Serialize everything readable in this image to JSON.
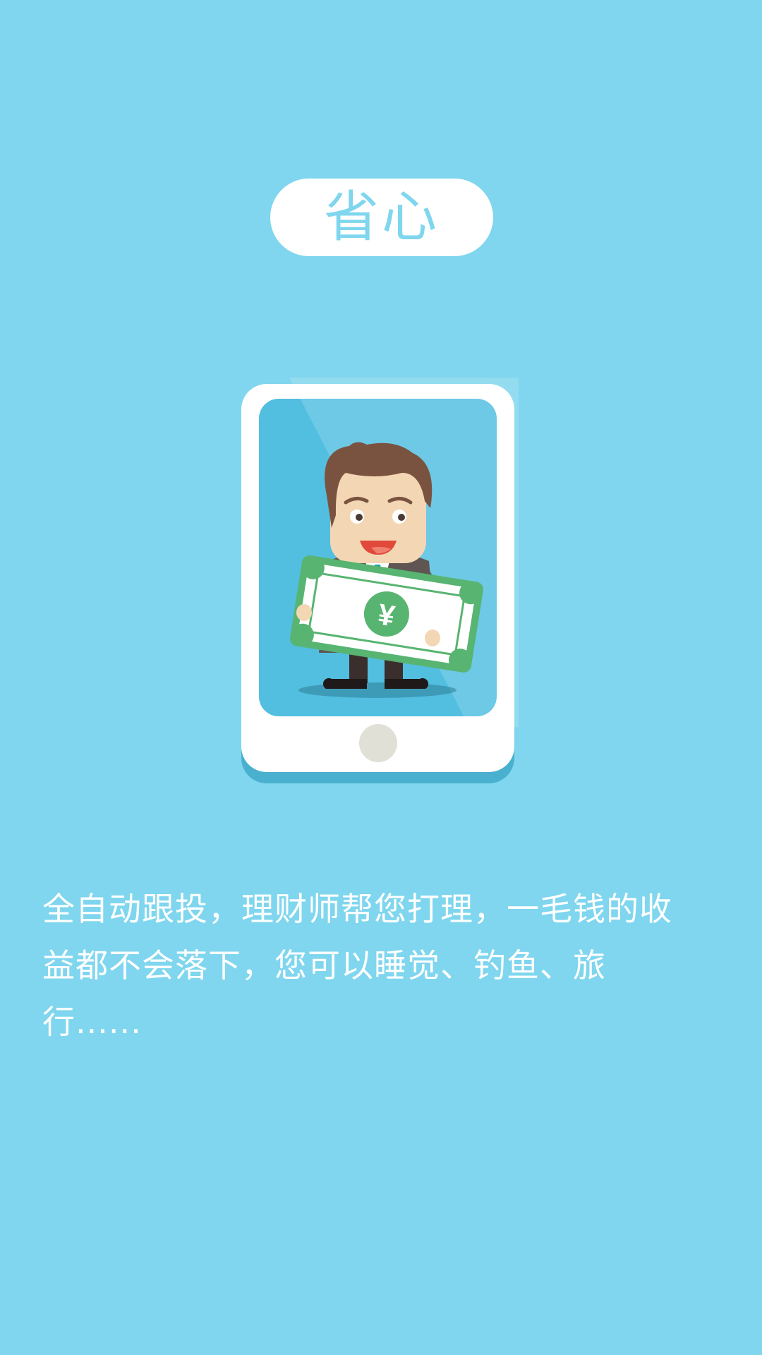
{
  "screen": {
    "title": "省心",
    "description": "全自动跟投，理财师帮您打理，一毛钱的收益都不会落下，您可以睡觉、钓鱼、旅行......",
    "currency_symbol": "¥"
  },
  "colors": {
    "background": "#7fd6ee",
    "pill_background": "#ffffff",
    "title_text": "#7fd6ee",
    "body_text": "#ffffff"
  },
  "illustration": {
    "subject": "businessman holding a banknote inside a smartphone",
    "icons": [
      "phone-icon",
      "businessman-icon",
      "banknote-icon",
      "home-button-icon"
    ]
  }
}
